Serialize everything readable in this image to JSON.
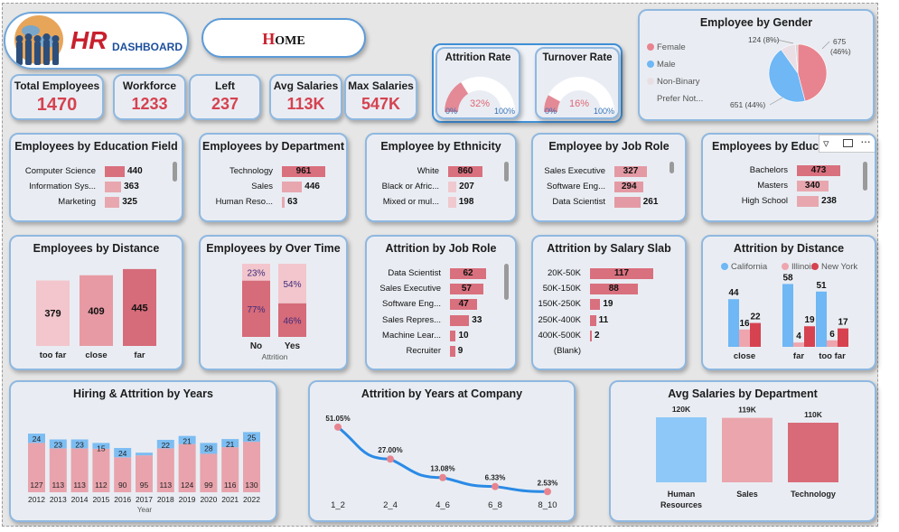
{
  "header": {
    "logo_hr": "HR",
    "logo_text": "DASHBOARD",
    "home_initial": "H",
    "home_rest": "OME"
  },
  "kpis": [
    {
      "title": "Total Employees",
      "value": "1470"
    },
    {
      "title": "Workforce",
      "value": "1233"
    },
    {
      "title": "Left",
      "value": "237"
    },
    {
      "title": "Avg Salaries",
      "value": "113K"
    },
    {
      "title": "Max Salaries",
      "value": "547K"
    }
  ],
  "gauges": [
    {
      "title": "Attrition Rate",
      "value_label": "32%",
      "min": "0%",
      "max": "100%",
      "fraction": 0.32
    },
    {
      "title": "Turnover Rate",
      "value_label": "16%",
      "min": "0%",
      "max": "100%",
      "fraction": 0.16
    }
  ],
  "gender": {
    "title": "Employee by Gender",
    "legend": [
      {
        "label": "Female",
        "color": "#e8848f"
      },
      {
        "label": "Male",
        "color": "#6fb7f5"
      },
      {
        "label": "Non-Binary",
        "color": "#e9dfe3"
      },
      {
        "label": "Prefer Not...",
        "color": ""
      }
    ],
    "slices": [
      {
        "value": 675,
        "label": "675",
        "pct": "(46%)",
        "color": "#e8848f"
      },
      {
        "value": 651,
        "label": "651 (44%)",
        "color": "#6fb7f5"
      },
      {
        "value": 124,
        "label": "124 (8%)",
        "color": "#eadfe4"
      },
      {
        "value": 20,
        "label": "",
        "color": "#d6d0d3"
      }
    ]
  },
  "education_field": {
    "title": "Employees by Education Field",
    "max": 961,
    "items": [
      {
        "label": "Computer Science",
        "value": "440"
      },
      {
        "label": "Information Sys...",
        "value": "363"
      },
      {
        "label": "Marketing",
        "value": "325"
      }
    ]
  },
  "department": {
    "title": "Employees by Department",
    "max": 961,
    "items": [
      {
        "label": "Technology",
        "value": "961"
      },
      {
        "label": "Sales",
        "value": "446"
      },
      {
        "label": "Human Reso...",
        "value": "63"
      }
    ]
  },
  "ethnicity": {
    "title": "Employee by Ethnicity",
    "max": 860,
    "items": [
      {
        "label": "White",
        "value": "860"
      },
      {
        "label": "Black or Afric...",
        "value": "207"
      },
      {
        "label": "Mixed or mul...",
        "value": "198"
      }
    ]
  },
  "job_role": {
    "title": "Employee by Job Role",
    "max": 327,
    "items": [
      {
        "label": "Sales Executive",
        "value": "327"
      },
      {
        "label": "Software Eng...",
        "value": "294"
      },
      {
        "label": "Data Scientist",
        "value": "261"
      }
    ]
  },
  "education": {
    "title": "Employees by Education",
    "max": 473,
    "items": [
      {
        "label": "Bachelors",
        "value": "473"
      },
      {
        "label": "Masters",
        "value": "340"
      },
      {
        "label": "High School",
        "value": "238"
      }
    ]
  },
  "attrition_job_role": {
    "title": "Attrition by Job Role",
    "max": 62,
    "items": [
      {
        "label": "Data Scientist",
        "value": "62"
      },
      {
        "label": "Sales Executive",
        "value": "57"
      },
      {
        "label": "Software Eng...",
        "value": "47"
      },
      {
        "label": "Sales Repres...",
        "value": "33"
      },
      {
        "label": "Machine Lear...",
        "value": "10"
      },
      {
        "label": "Recruiter",
        "value": "9"
      }
    ]
  },
  "salary_slab": {
    "title": "Attrition by Salary Slab",
    "max": 117,
    "items": [
      {
        "label": "20K-50K",
        "value": "117"
      },
      {
        "label": "50K-150K",
        "value": "88"
      },
      {
        "label": "150K-250K",
        "value": "19"
      },
      {
        "label": "250K-400K",
        "value": "11"
      },
      {
        "label": "400K-500K",
        "value": "2"
      },
      {
        "label": "(Blank)",
        "value": ""
      }
    ]
  },
  "charts": {
    "distance": {
      "type": "bar",
      "title": "Employees by Distance",
      "categories": [
        "too far",
        "close",
        "far"
      ],
      "values": [
        379,
        409,
        445
      ],
      "colors": [
        "#f2c6cc",
        "#e79aa4",
        "#d66b79"
      ],
      "ylim": [
        0,
        460
      ]
    },
    "overtime": {
      "type": "bar",
      "title": "Employees by Over Time",
      "categories": [
        "No",
        "Yes"
      ],
      "xlabel": "Attrition",
      "series": [
        {
          "name": "",
          "values": [
            77,
            46
          ],
          "labels": [
            "77%",
            "46%"
          ],
          "color": "#d66b79"
        },
        {
          "name": "",
          "values": [
            23,
            54
          ],
          "labels": [
            "23%",
            "54%"
          ],
          "color": "#f2c6cc"
        }
      ]
    },
    "attrition_distance": {
      "type": "bar",
      "title": "Attrition by Distance",
      "categories": [
        "close",
        "far",
        "too far"
      ],
      "series": [
        {
          "name": "California",
          "values": [
            44,
            58,
            51
          ],
          "color": "#6fb7f5"
        },
        {
          "name": "Illinois",
          "values": [
            16,
            4,
            6
          ],
          "color": "#eea5ae"
        },
        {
          "name": "New York",
          "values": [
            22,
            19,
            17
          ],
          "color": "#d64250"
        }
      ],
      "ylim": [
        0,
        60
      ]
    },
    "hiring": {
      "type": "bar",
      "title": "Hiring & Attrition by Years",
      "xlabel": "Year",
      "categories": [
        "2012",
        "2013",
        "2014",
        "2015",
        "2016",
        "2017",
        "2018",
        "2019",
        "2020",
        "2021",
        "2022"
      ],
      "series": [
        {
          "name": "",
          "values": [
            127,
            113,
            113,
            112,
            90,
            95,
            113,
            124,
            99,
            116,
            130
          ],
          "color": "#e8a3ac"
        },
        {
          "name": "",
          "values": [
            24,
            23,
            23,
            15,
            24,
            6,
            22,
            21,
            28,
            21,
            25
          ],
          "color": "#7cbdf2"
        }
      ],
      "value_labels_top": [
        "24",
        "23",
        "23",
        "15",
        "24",
        "",
        "22",
        "21",
        "28",
        "21",
        "25"
      ],
      "ylim": [
        0,
        160
      ]
    },
    "years_company": {
      "type": "line",
      "title": "Attrition by Years at Company",
      "categories": [
        "1_2",
        "2_4",
        "4_6",
        "6_8",
        "8_10"
      ],
      "values": [
        51.05,
        27.0,
        13.08,
        6.33,
        2.53
      ],
      "labels": [
        "51.05%",
        "27.00%",
        "13.08%",
        "6.33%",
        "2.53%"
      ],
      "ylim": [
        0,
        55
      ]
    },
    "avg_salary_dept": {
      "type": "bar",
      "title": "Avg Salaries by Department",
      "categories": [
        "Human Resources",
        "Sales",
        "Technology"
      ],
      "cat_lines": [
        [
          "Human",
          "Resources"
        ],
        [
          "Sales"
        ],
        [
          "Technology"
        ]
      ],
      "values": [
        120,
        119,
        110
      ],
      "labels": [
        "120K",
        "119K",
        "110K"
      ],
      "colors": [
        "#8ec8f8",
        "#eaa5ad",
        "#d96b79"
      ],
      "ylim": [
        0,
        125
      ]
    }
  }
}
